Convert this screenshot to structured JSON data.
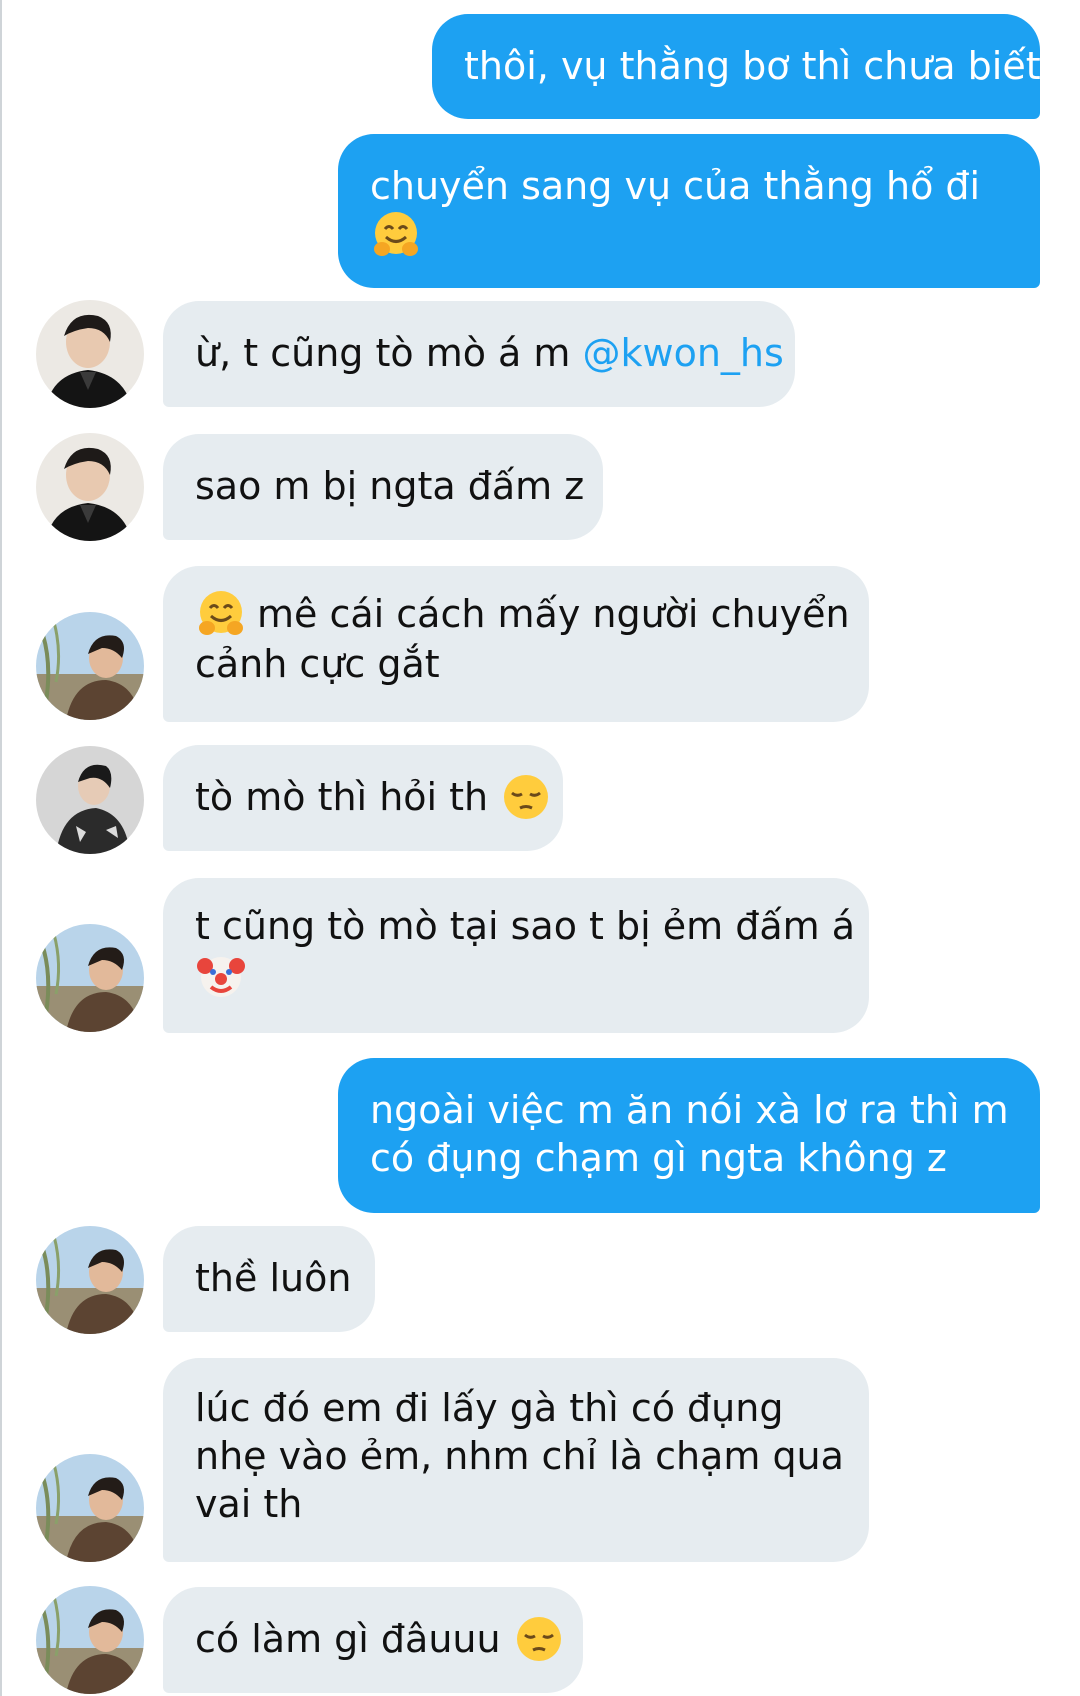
{
  "messages": [
    {
      "dir": "out",
      "lines": [
        "thôi, vụ thằng bơ thì chưa biết"
      ]
    },
    {
      "dir": "out",
      "lines": [
        "chuyển sang vụ của thằng hổ đi"
      ],
      "emoji_after": "hugging-face"
    },
    {
      "dir": "in",
      "avatar": "user-a",
      "text": "ừ, t cũng tò mò á m ",
      "mention": "@kwon_hs"
    },
    {
      "dir": "in",
      "avatar": "user-a",
      "lines": [
        "sao m bị ngta đấm z"
      ]
    },
    {
      "dir": "in",
      "avatar": "user-b",
      "emoji_before": "hugging-face",
      "lines": [
        "mê cái cách mấy người chuyển",
        "cảnh cực gắt"
      ]
    },
    {
      "dir": "in",
      "avatar": "user-c",
      "text": "tò mò thì hỏi th ",
      "emoji_inline": "pensive-face"
    },
    {
      "dir": "in",
      "avatar": "user-b",
      "lines": [
        "t cũng tò mò tại sao t bị ẻm đấm á"
      ],
      "emoji_after": "clown-face"
    },
    {
      "dir": "out",
      "lines": [
        "ngoài việc m ăn nói xà lơ ra thì m",
        "có đụng chạm gì ngta không z"
      ]
    },
    {
      "dir": "in",
      "avatar": "user-b",
      "lines": [
        "thề luôn"
      ]
    },
    {
      "dir": "in",
      "avatar": "user-b",
      "lines": [
        "lúc đó em đi lấy gà thì có đụng",
        "nhẹ vào ẻm, nhm chỉ là chạm qua",
        "vai th"
      ]
    },
    {
      "dir": "in",
      "avatar": "user-b",
      "text": "có làm gì đâuuu ",
      "emoji_inline": "pensive-face"
    }
  ],
  "colors": {
    "outgoing_bubble": "#1da1f2",
    "incoming_bubble": "#e6ecf0",
    "mention": "#1da1f2"
  }
}
